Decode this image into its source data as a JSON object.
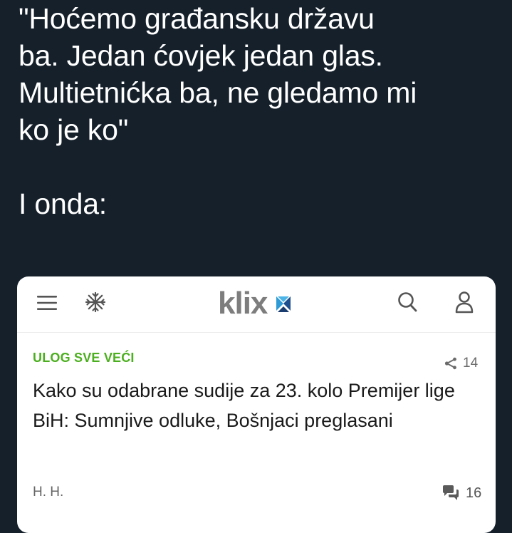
{
  "tweet": {
    "lines": [
      "\"Hoćemo građansku državu",
      "ba. Jedan ćovjek jedan glas.",
      "Multietnićka ba, ne gledamo mi",
      "ko je ko\""
    ],
    "followup": "I onda:"
  },
  "card": {
    "header": {
      "logo_text": "klix",
      "icons": [
        "menu-icon",
        "snowflake-icon",
        "search-icon",
        "user-icon"
      ]
    },
    "article": {
      "category": "ULOG SVE VEĆI",
      "share_count": "14",
      "headline": "Kako su odabrane sudije za 23. kolo Premijer lige BiH: Sumnjive odluke, Bošnjaci preglasani",
      "author": "H. H.",
      "comment_count": "16"
    }
  },
  "colors": {
    "background": "#15202b",
    "card": "#ffffff",
    "category": "#4caf1f",
    "logo": "#7d7d7d"
  }
}
